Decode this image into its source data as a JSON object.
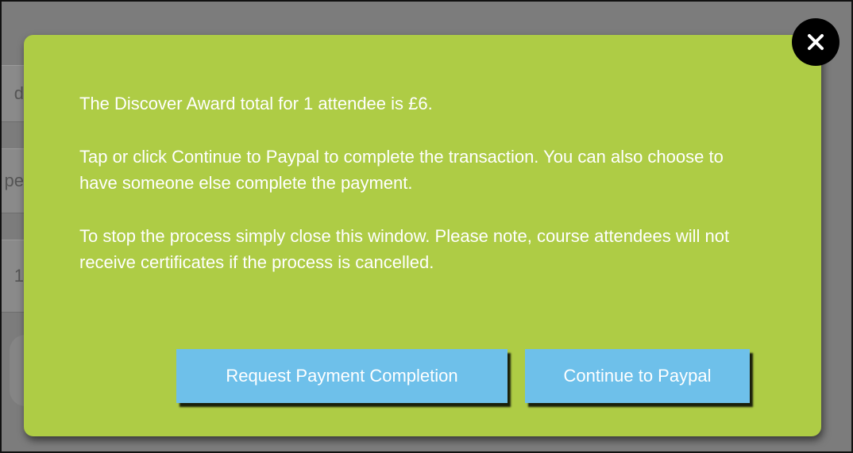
{
  "modal": {
    "paragraphs": [
      "The Discover Award total for 1 attendee is £6.",
      "Tap or click Continue to Paypal to complete the transaction. You can also choose to have someone else complete the payment.",
      "To stop the process simply close this window. Please note, course attendees will not receive certificates if the process is cancelled."
    ],
    "buttons": {
      "request_label": "Request Payment Completion",
      "paypal_label": "Continue to Paypal"
    },
    "close_icon": "close-icon"
  },
  "background": {
    "fragments": [
      "d",
      "pe",
      "1"
    ]
  },
  "colors": {
    "modal_bg": "#aecc45",
    "button_bg": "#6ec0ea",
    "overlay": "#7c7c7c",
    "close_bg": "#000000"
  }
}
